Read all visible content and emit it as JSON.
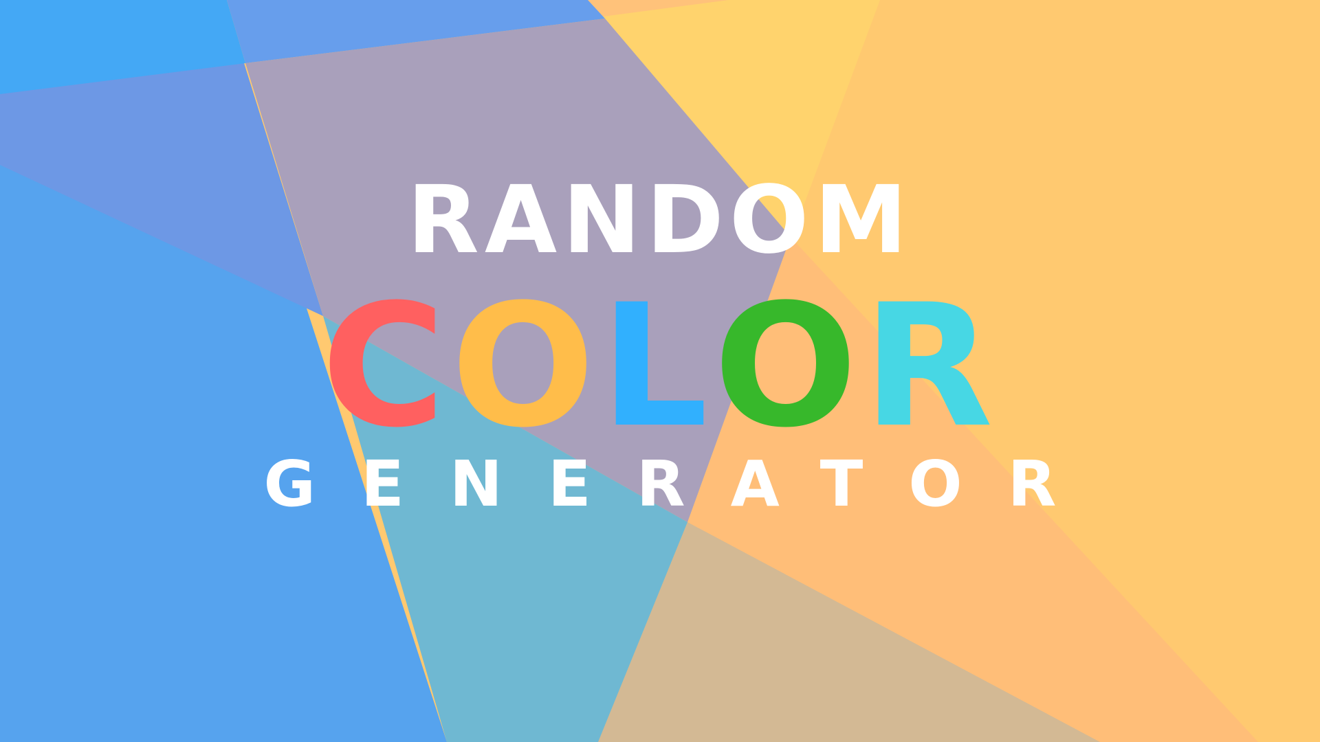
{
  "background": {
    "colors": {
      "blue_bright": "#44A8F5",
      "blue_main": "#56A3EE",
      "periwinkle": "#6D98E5",
      "periwinkle_top": "#679EEC",
      "mauve": "#A9A0BB",
      "teal": "#6FB8D2",
      "yellow": "#FFD36D",
      "amber": "#FFC970",
      "orange": "#FFBE78",
      "tan": "#D3B994",
      "peach": "#FFC27A"
    }
  },
  "title": {
    "line1": "RANDOM",
    "line2_letters": [
      {
        "char": "C",
        "color": "#FF6060"
      },
      {
        "char": "O",
        "color": "#FFBD4A"
      },
      {
        "char": "L",
        "color": "#31B0FE"
      },
      {
        "char": "O",
        "color": "#37B82B"
      },
      {
        "char": "R",
        "color": "#47D7E4"
      }
    ],
    "line3": "GENERATOR",
    "text_color": "#FFFFFF"
  }
}
